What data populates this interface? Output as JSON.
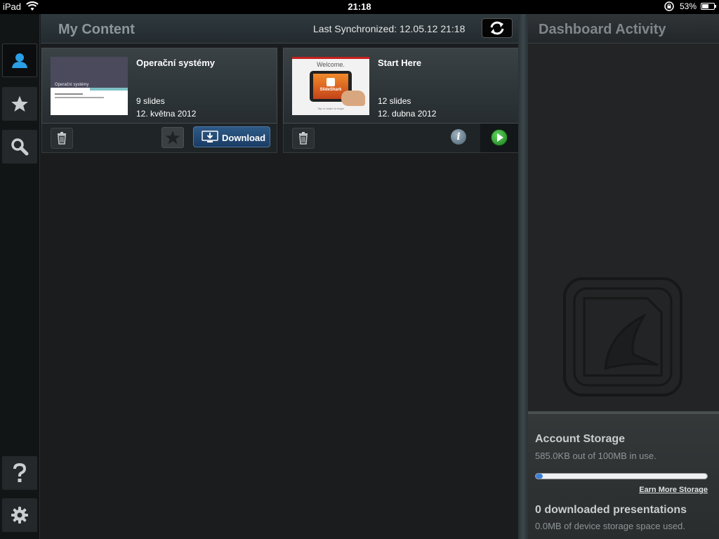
{
  "status_bar": {
    "device": "iPad",
    "time": "21:18",
    "battery": "53%"
  },
  "content": {
    "title": "My Content",
    "last_sync": "Last Synchronized: 12.05.12 21:18",
    "cards": [
      {
        "title": "Operační systémy",
        "slides": "9 slides",
        "date": "12. května 2012",
        "thumb_title": "Operační systémy",
        "download_label": "Download"
      },
      {
        "title": "Start Here",
        "slides": "12 slides",
        "date": "12. dubna 2012",
        "thumb_welcome": "Welcome.",
        "thumb_brand": "SlideShark",
        "thumb_tap": "Tap or swipe to begin"
      }
    ]
  },
  "dashboard": {
    "title": "Dashboard Activity"
  },
  "storage": {
    "title": "Account Storage",
    "usage": "585.0KB out of 100MB in use.",
    "used_fraction": 0.006,
    "earn_more": "Earn More Storage",
    "downloaded": "0 downloaded presentations",
    "device_usage": "0.0MB of device storage space used."
  },
  "colors": {
    "accent_blue": "#2a9fe6",
    "download_blue": "#2e5a88",
    "play_green": "#3bb33b"
  }
}
